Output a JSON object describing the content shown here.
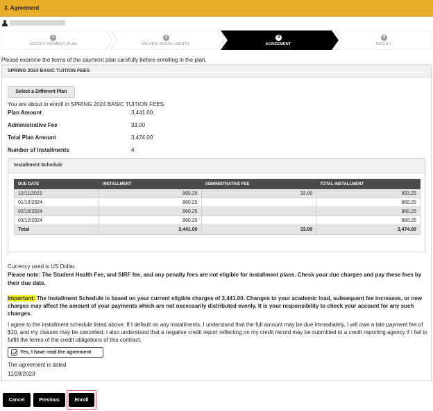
{
  "header": {
    "title": "3. Agreement"
  },
  "steps": [
    {
      "number": "1",
      "label": "SELECT PAYMENT PLAN"
    },
    {
      "number": "2",
      "label": "REVIEW INSTALLMENTS"
    },
    {
      "number": "3",
      "label": "AGREEMENT"
    },
    {
      "number": "4",
      "label": "RESULT"
    }
  ],
  "intro": "Please examine the terms of the payment plan carefully before enrolling in the plan.",
  "plan": {
    "title": "SPRING 2024 BASIC TUITION FEES",
    "select_different_label": "Select a Different Plan",
    "enroll_note": "You are about to enroll in SPRING 2024 BASIC TUITION FEES.",
    "rows": [
      {
        "key": "Plan Amount",
        "value": "3,441.00"
      },
      {
        "key": "Administrative Fee",
        "value": "33.00"
      },
      {
        "key": "Total Plan Amount",
        "value": "3,474.00"
      },
      {
        "key": "Number of Installments",
        "value": "4"
      }
    ]
  },
  "schedule": {
    "title": "Installment Schedule",
    "columns": [
      "DUE DATE",
      "INSTALLMENT",
      "ADMINISTRATIVE FEE",
      "TOTAL INSTALLMENT"
    ],
    "rows": [
      [
        "12/11/2023",
        "860.25",
        "33.00",
        "893.25"
      ],
      [
        "01/10/2024",
        "860.25",
        "",
        "860.25"
      ],
      [
        "02/10/2024",
        "860.25",
        "",
        "860.25"
      ],
      [
        "03/12/2024",
        "860.25",
        "",
        "860.25"
      ]
    ],
    "total": [
      "Total",
      "3,441.00",
      "33.00",
      "3,474.00"
    ]
  },
  "currency": "Currency used is US Dollar.",
  "please_note": {
    "lead": "Please note:",
    "text": " The Student Health Fee, and SIRF fee, and any penalty fees are not eligible for installment plans. Check your due charges and pay these fees by their due date."
  },
  "important": {
    "lead": "Important:",
    "text": " The Installment Schedule is based on your current eligible charges of 3,441.00.  Changes to your academic load, subsequent fee increases, or new charges may affect the amount of your payments which are not necessarily distributed evenly.  It is your responsibility to check your account for any such changes."
  },
  "agreement_text": "I agree to the installment schedule listed above.   If I default on any installments, I understand that the full amount may be due immediately, I will owe a late payment fee of $10, and my classes may be cancelled. I also understand that a negative credit report reflecting on my credit record may be submitted to a credit reporting agency if I fail to fulfill the terms of the credit obligations of this contract.",
  "checkbox_label": "Yes, I have read the agreement",
  "dated_label": "The agreement is dated",
  "dated_value": "11/28/2023",
  "actions": {
    "cancel": "Cancel",
    "previous": "Previous",
    "enroll": "Enroll"
  },
  "colors": {
    "header_bg": "#e9ad2a",
    "active_step_bg": "#000000",
    "highlight": "#f4f400",
    "table_header_bg": "#4a4a4a",
    "enroll_ring": "#e05a70"
  }
}
